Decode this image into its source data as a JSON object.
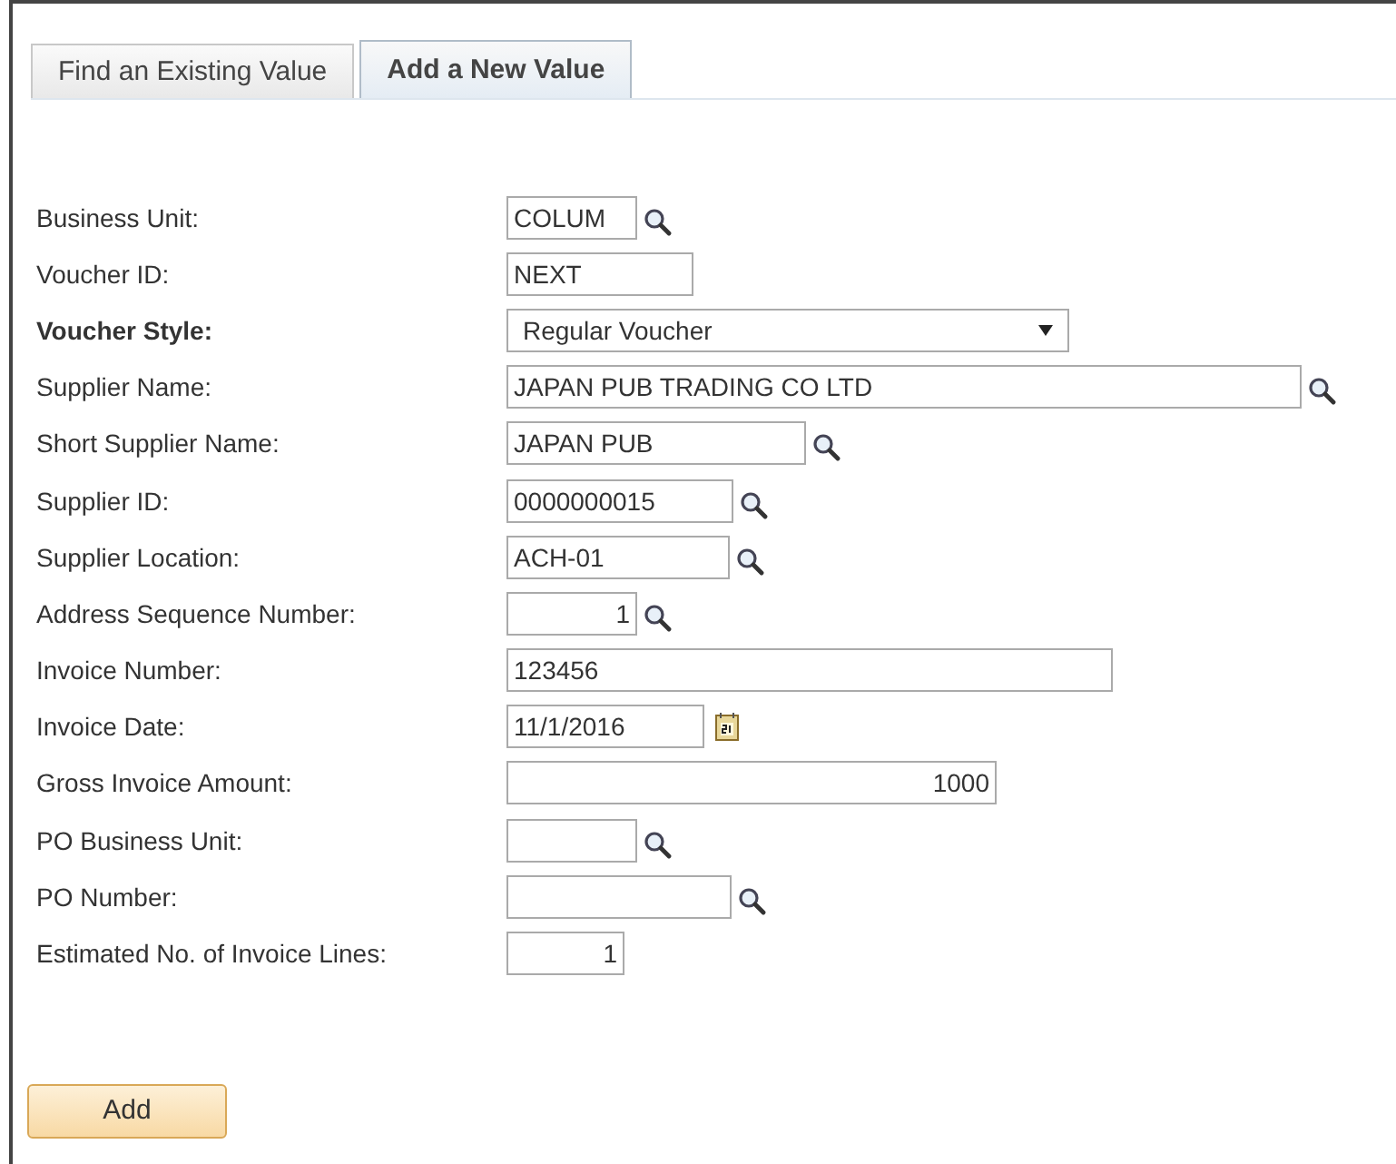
{
  "tabs": [
    {
      "label": "Find an Existing Value",
      "selected": false
    },
    {
      "label": "Add a New Value",
      "selected": true
    }
  ],
  "fields": [
    {
      "label": "Business Unit:",
      "value": "COLUM",
      "kind": "text",
      "lookup": true,
      "required": false
    },
    {
      "label": "Voucher ID:",
      "value": "NEXT",
      "kind": "text",
      "lookup": false,
      "required": false
    },
    {
      "label": "Voucher Style:",
      "value": "Regular Voucher",
      "kind": "select",
      "lookup": false,
      "required": true
    },
    {
      "label": "Supplier Name:",
      "value": "JAPAN PUB TRADING CO LTD",
      "kind": "text",
      "lookup": true,
      "required": false
    },
    {
      "label": "Short Supplier Name:",
      "value": "JAPAN PUB",
      "kind": "text",
      "lookup": true,
      "required": false
    },
    {
      "label": "Supplier ID:",
      "value": "0000000015",
      "kind": "text",
      "lookup": true,
      "required": false
    },
    {
      "label": "Supplier Location:",
      "value": "ACH-01",
      "kind": "text",
      "lookup": true,
      "required": false
    },
    {
      "label": "Address Sequence Number:",
      "value": "1",
      "kind": "number",
      "lookup": true,
      "required": false
    },
    {
      "label": "Invoice Number:",
      "value": "123456",
      "kind": "text",
      "lookup": false,
      "required": false
    },
    {
      "label": "Invoice Date:",
      "value": "11/1/2016",
      "kind": "date",
      "lookup": false,
      "required": false
    },
    {
      "label": "Gross Invoice Amount:",
      "value": "1000",
      "kind": "number",
      "lookup": false,
      "required": false
    },
    {
      "label": "PO Business Unit:",
      "kind": "text",
      "lookup": true,
      "required": false
    },
    {
      "label": "PO Number:",
      "kind": "text",
      "lookup": true,
      "required": false
    },
    {
      "label": "Estimated No. of Invoice Lines:",
      "value": "1",
      "kind": "number",
      "lookup": false,
      "required": false
    }
  ],
  "button": "Add"
}
